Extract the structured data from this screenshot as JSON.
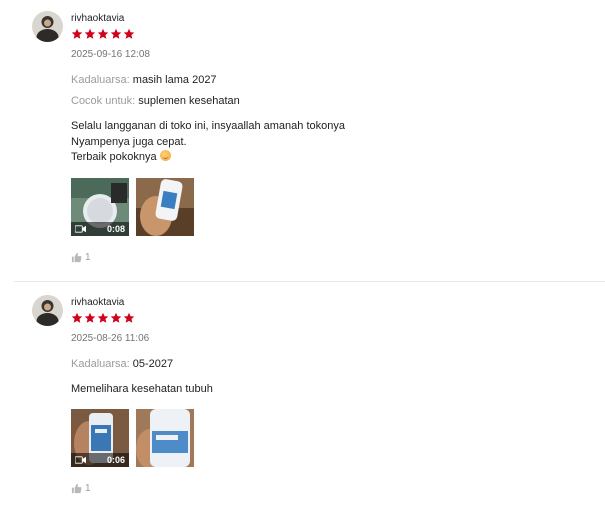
{
  "reviews": [
    {
      "username": "rivhaoktavia",
      "rating": 5,
      "date": "2025-09-16 12:08",
      "attributes": [
        {
          "key": "Kadaluarsa:",
          "value": "masih lama 2027"
        },
        {
          "key": "Cocok untuk:",
          "value": "suplemen kesehatan"
        }
      ],
      "text_lines": [
        "Selalu langganan di toko ini, insyaallah amanah tokonya",
        "Nyampenya juga cepat.",
        "Terbaik pokoknya"
      ],
      "media": [
        {
          "type": "video",
          "duration": "0:08"
        },
        {
          "type": "image"
        }
      ],
      "likes": "1"
    },
    {
      "username": "rivhaoktavia",
      "rating": 5,
      "date": "2025-08-26 11:06",
      "attributes": [
        {
          "key": "Kadaluarsa:",
          "value": "05-2027"
        }
      ],
      "text_lines": [
        "Memelihara kesehatan tubuh"
      ],
      "media": [
        {
          "type": "video",
          "duration": "0:06"
        },
        {
          "type": "image"
        }
      ],
      "likes": "1"
    }
  ],
  "icons": {
    "star": "star-icon",
    "video": "video-camera-icon",
    "like": "thumbs-up-icon"
  },
  "colors": {
    "star": "#d0011b",
    "muted": "#9b9b9b",
    "text": "#222222"
  }
}
